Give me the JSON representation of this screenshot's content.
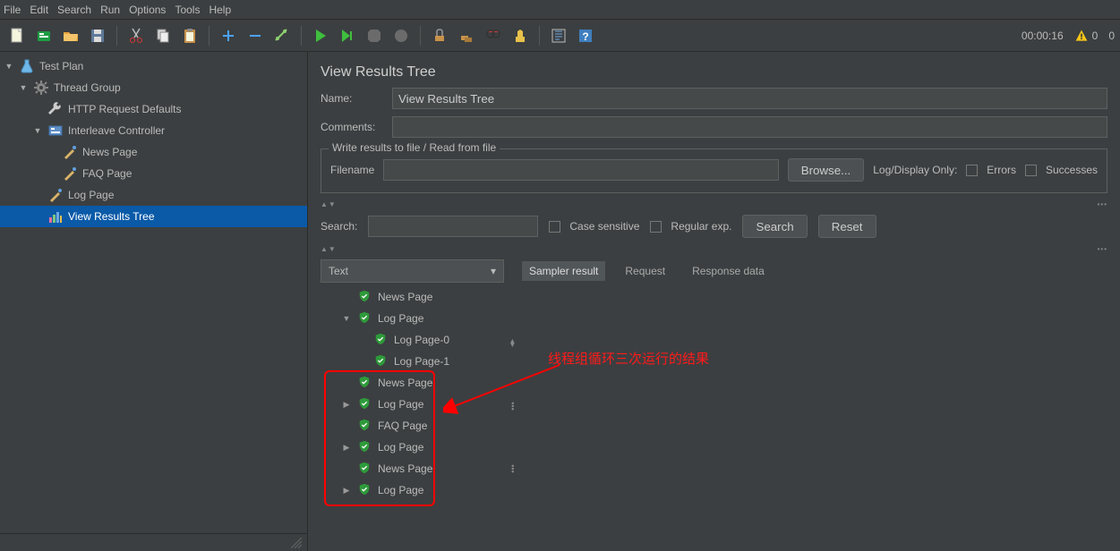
{
  "menu": {
    "items": [
      "File",
      "Edit",
      "Search",
      "Run",
      "Options",
      "Tools",
      "Help"
    ]
  },
  "toolbar": {
    "timer": "00:00:16",
    "warn_count": "0",
    "err_count": "0"
  },
  "tree": {
    "root": {
      "label": "Test Plan"
    },
    "thread_group": {
      "label": "Thread Group"
    },
    "http_defaults": {
      "label": "HTTP Request Defaults"
    },
    "interleave": {
      "label": "Interleave Controller"
    },
    "news_page": {
      "label": "News Page"
    },
    "faq_page": {
      "label": "FAQ Page"
    },
    "log_page": {
      "label": "Log Page"
    },
    "view_results": {
      "label": "View Results Tree"
    }
  },
  "panel": {
    "title": "View Results Tree",
    "name_label": "Name:",
    "name_value": "View Results Tree",
    "comments_label": "Comments:",
    "comments_value": "",
    "write_legend": "Write results to file / Read from file",
    "filename_label": "Filename",
    "filename_value": "",
    "browse_btn": "Browse...",
    "logdisplay_label": "Log/Display Only:",
    "errors_label": "Errors",
    "successes_label": "Successes",
    "search_label": "Search:",
    "search_value": "",
    "case_label": "Case sensitive",
    "regex_label": "Regular exp.",
    "search_btn": "Search",
    "reset_btn": "Reset",
    "combo_value": "Text",
    "tabs": {
      "sampler": "Sampler result",
      "request": "Request",
      "response": "Response data"
    }
  },
  "results": {
    "items": [
      {
        "label": "News Page",
        "indent": 1,
        "toggle": ""
      },
      {
        "label": "Log Page",
        "indent": 1,
        "toggle": "▼"
      },
      {
        "label": "Log Page-0",
        "indent": 2,
        "toggle": ""
      },
      {
        "label": "Log Page-1",
        "indent": 2,
        "toggle": ""
      },
      {
        "label": "News Page",
        "indent": 1,
        "toggle": ""
      },
      {
        "label": "Log Page",
        "indent": 1,
        "toggle": "▶"
      },
      {
        "label": "FAQ Page",
        "indent": 1,
        "toggle": ""
      },
      {
        "label": "Log Page",
        "indent": 1,
        "toggle": "▶"
      },
      {
        "label": "News Page",
        "indent": 1,
        "toggle": ""
      },
      {
        "label": "Log Page",
        "indent": 1,
        "toggle": "▶"
      }
    ]
  },
  "annotation": {
    "text": "线程组循环三次运行的结果"
  }
}
